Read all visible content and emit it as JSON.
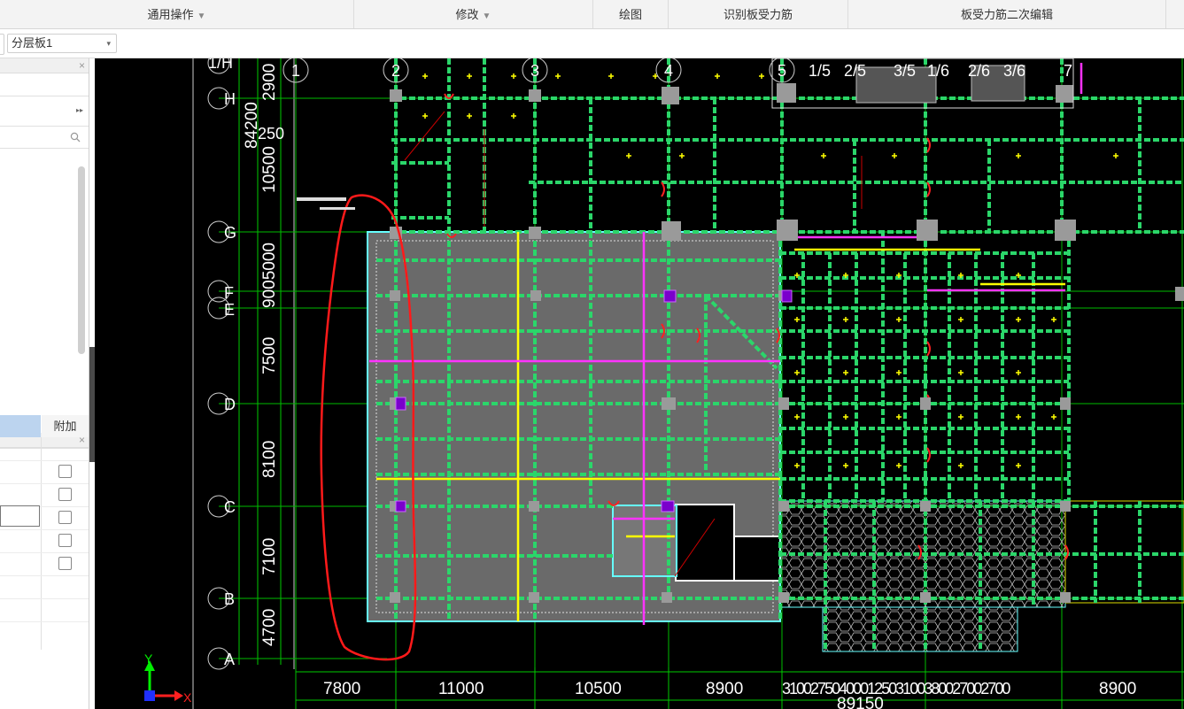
{
  "ribbon": {
    "common_ops": "通用操作",
    "modify": "修改",
    "draw": "绘图",
    "identify_rebar": "识别板受力筋",
    "rebar_secondary_edit": "板受力筋二次编辑",
    "dropdown_caret": "▼"
  },
  "options_bar": {
    "layer_select": "分层板1",
    "dropdown_caret": "▾"
  },
  "left_panel": {
    "close_symbol": "×",
    "expand_symbol": "▸▸",
    "search_icon": "search-icon",
    "property_grid": {
      "header_additional": "附加",
      "rows": [
        {
          "additional_checked": false
        },
        {
          "additional_checked": false
        },
        {
          "additional_checked": false
        },
        {
          "additional_checked": false
        },
        {
          "additional_checked": false
        }
      ]
    }
  },
  "drawing": {
    "colors": {
      "background": "#000000",
      "beam": "#2bd66a",
      "slab_fill": "#6a6a6a",
      "axis_line": "#00cc00",
      "rebar_yellow": "#ffff00",
      "rebar_magenta": "#ff33ff",
      "annotation_red": "#ff2020",
      "slab_edge_cyan": "#66ffff",
      "column_gray": "#9a9a9a"
    },
    "horizontal_axes": [
      "1/H",
      "H",
      "G",
      "F",
      "E",
      "D",
      "C",
      "B",
      "A"
    ],
    "vertical_axes": [
      "1",
      "2",
      "3",
      "4",
      "5",
      "1/5",
      "2/5",
      "3/5",
      "1/6",
      "2/6",
      "3/6",
      "7"
    ],
    "left_dimensions": [
      "2900",
      "84200",
      "250",
      "10500",
      "9005000",
      "7500",
      "8100",
      "7100",
      "4700"
    ],
    "bottom_dimensions": [
      "7800",
      "11000",
      "10500",
      "8900",
      "3100",
      "2750",
      "4000",
      "1250",
      "3100",
      "3800",
      "2700",
      "8900"
    ],
    "bottom_dimensions_joined": "31002750400012503100380027002700",
    "bottom_total": "89150",
    "ucs_x": "X",
    "ucs_y": "Y"
  }
}
